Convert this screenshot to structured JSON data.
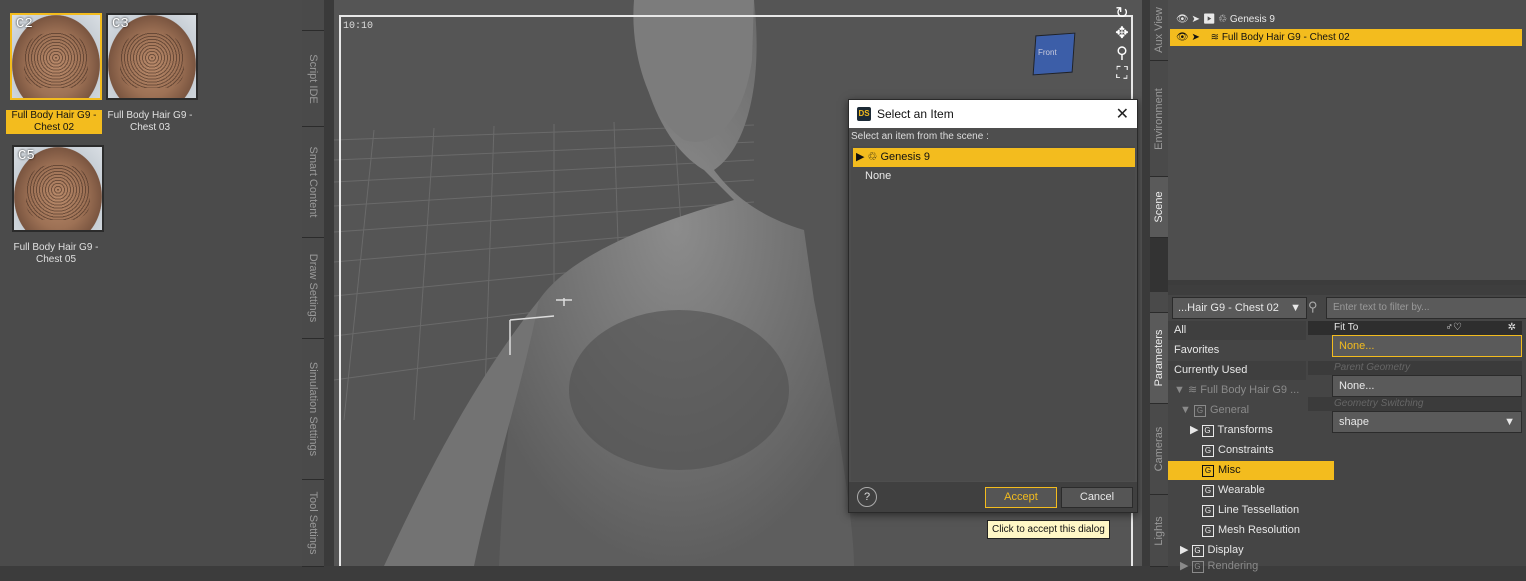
{
  "library": {
    "items": [
      {
        "code": "C2",
        "label": "Full Body Hair G9 - Chest 02",
        "selected": true
      },
      {
        "code": "C3",
        "label": "Full Body Hair G9 - Chest 03",
        "selected": false
      },
      {
        "code": "C5",
        "label": "Full Body Hair G9 - Chest 05",
        "selected": false
      }
    ]
  },
  "left_tabs": [
    "Script IDE",
    "Smart Content",
    "Draw Settings",
    "Simulation Settings",
    "Tool Settings"
  ],
  "viewport": {
    "time": "10:10",
    "gizmo_label": "Front"
  },
  "dialog": {
    "title": "Select an Item",
    "prompt": "Select an item from the scene :",
    "items": [
      {
        "label": "Genesis 9",
        "selected": true
      },
      {
        "label": "None",
        "selected": false
      }
    ],
    "help": "?",
    "accept": "Accept",
    "cancel": "Cancel",
    "tooltip": "Click to accept this dialog"
  },
  "right_tabs": [
    "Aux View",
    "Environment",
    "Scene",
    "Parameters",
    "Cameras",
    "Lights"
  ],
  "scene": {
    "rows": [
      {
        "label": "Genesis 9",
        "selected": false
      },
      {
        "label": "Full Body Hair G9 - Chest 02",
        "selected": true
      }
    ]
  },
  "parameters": {
    "node": "...Hair G9 - Chest 02",
    "filter_placeholder": "Enter text to filter by...",
    "groups": [
      {
        "label": "All",
        "selected": false
      },
      {
        "label": "Favorites",
        "selected": false
      },
      {
        "label": "Currently Used",
        "selected": false
      },
      {
        "label": "Full Body Hair G9 ...",
        "selected": false
      },
      {
        "label": "General",
        "selected": false
      },
      {
        "label": "Transforms",
        "selected": false
      },
      {
        "label": "Constraints",
        "selected": false
      },
      {
        "label": "Misc",
        "selected": true
      },
      {
        "label": "Wearable",
        "selected": false
      },
      {
        "label": "Line Tessellation",
        "selected": false
      },
      {
        "label": "Mesh Resolution",
        "selected": false
      },
      {
        "label": "Display",
        "selected": false
      },
      {
        "label": "Rendering",
        "selected": false
      }
    ],
    "properties": [
      {
        "name": "Fit To",
        "value": "None..."
      },
      {
        "name": "Parent Geometry",
        "value": "None..."
      },
      {
        "name": "Geometry Switching",
        "value": "shape"
      }
    ]
  },
  "colors": {
    "accent": "#f3bc1e",
    "panel": "#4b4b4b",
    "viewport": "#555555"
  }
}
